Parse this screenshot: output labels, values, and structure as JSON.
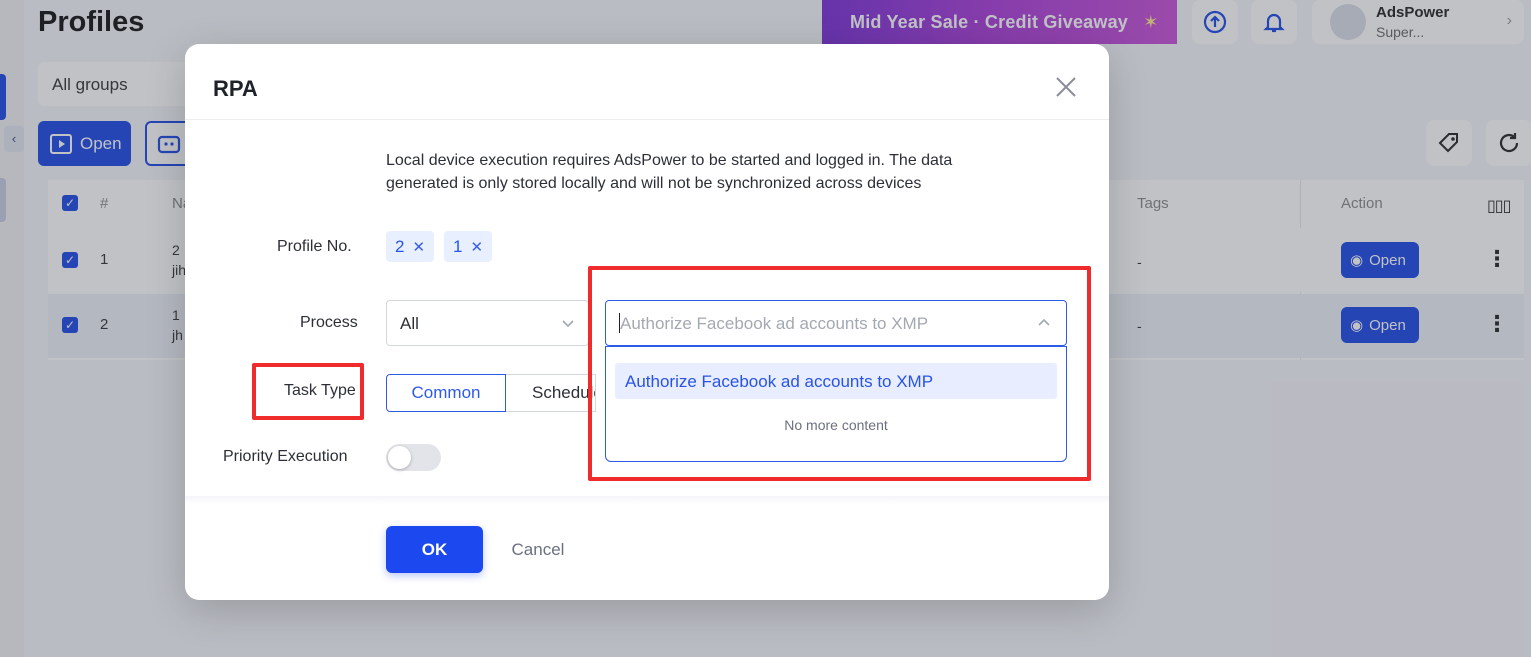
{
  "app": {
    "page_title": "Profiles",
    "promo_banner": "Mid Year Sale · Credit Giveaway",
    "user": {
      "name": "AdsPower",
      "plan": "Super..."
    },
    "group_select": "All groups",
    "open_button": "Open",
    "table": {
      "headers": {
        "index": "#",
        "name": "Na",
        "tags": "Tags",
        "action": "Action"
      },
      "rows": [
        {
          "index": "1",
          "name_line1": "2",
          "name_line2": "jih",
          "tags": "-",
          "action": "Open"
        },
        {
          "index": "2",
          "name_line1": "1",
          "name_line2": "jh",
          "tags": "-",
          "action": "Open"
        }
      ]
    }
  },
  "modal": {
    "title": "RPA",
    "notice": "Local device execution requires AdsPower to be started and logged in. The data generated is only stored locally and will not be synchronized across devices",
    "profile_label": "Profile No.",
    "profile_tags": [
      "2",
      "1"
    ],
    "process_label": "Process",
    "process_value": "All",
    "flow_placeholder": "Authorize Facebook ad accounts to XMP",
    "dropdown": {
      "option": "Authorize Facebook ad accounts to XMP",
      "empty_text": "No more content"
    },
    "task_type_label": "Task Type",
    "task_type_options": [
      "Common",
      "Scheduled"
    ],
    "priority_label": "Priority Execution",
    "priority_enabled": false,
    "ok_label": "OK",
    "cancel_label": "Cancel"
  },
  "colors": {
    "primary": "#1c48e6",
    "annotation": "#ef2b2b",
    "promo": "#a93ad8"
  }
}
